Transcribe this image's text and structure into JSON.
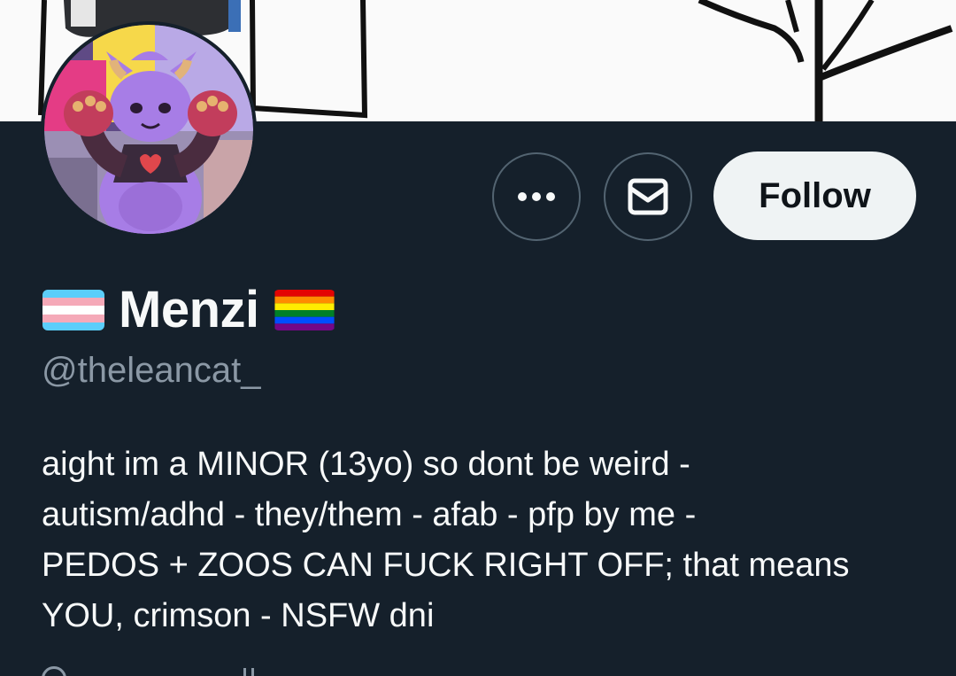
{
  "profile": {
    "display_name": "Menzi",
    "handle": "@theleancat_",
    "bio_lines": [
      "aight im a MINOR  (13yo) so dont be weird -",
      "autism/adhd  - they/them - afab - pfp by me -",
      "PEDOS + ZOOS CAN FUCK RIGHT OFF; that means",
      "YOU, crimson - NSFW dni"
    ],
    "name_prefix_icon": "transgender-flag-emoji",
    "name_suffix_icon": "rainbow-flag-emoji"
  },
  "actions": {
    "more_icon": "more-dots-icon",
    "message_icon": "envelope-icon",
    "follow_label": "Follow"
  },
  "colors": {
    "background": "#15202b",
    "follow_button_bg": "#eff3f4",
    "follow_button_text": "#0f1419",
    "secondary_text": "#8b98a5",
    "primary_text": "#f7f9f9",
    "button_border": "#536471"
  }
}
